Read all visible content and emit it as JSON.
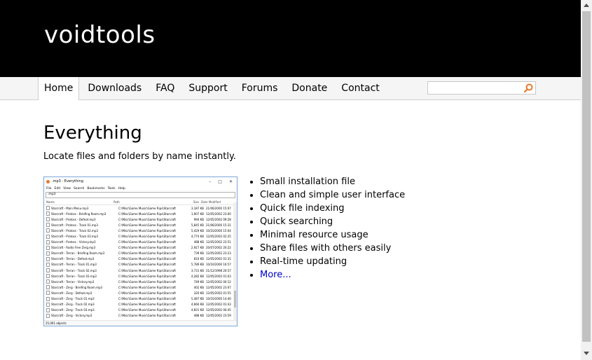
{
  "site": {
    "logo": "voidtools"
  },
  "nav": {
    "items": [
      {
        "label": "Home",
        "active": true
      },
      {
        "label": "Downloads"
      },
      {
        "label": "FAQ"
      },
      {
        "label": "Support"
      },
      {
        "label": "Forums"
      },
      {
        "label": "Donate"
      },
      {
        "label": "Contact"
      }
    ],
    "search_value": ""
  },
  "main": {
    "title": "Everything",
    "subtitle": "Locate files and folders by name instantly.",
    "features": [
      "Small installation file",
      "Clean and simple user interface",
      "Quick file indexing",
      "Quick searching",
      "Minimal resource usage",
      "Share files with others easily",
      "Real-time updating"
    ],
    "more_link": "More..."
  },
  "screenshot": {
    "window_title": ".mp3 - Everything",
    "menu": [
      "File",
      "Edit",
      "View",
      "Search",
      "Bookmarks",
      "Tools",
      "Help"
    ],
    "search_text": ".mp3",
    "columns": [
      "Name",
      "Path",
      "Size",
      "Date Modified"
    ],
    "rows": [
      [
        "Starcraft - Main Menu.mp3",
        "C:\\Misc\\Game Music\\Game Rips\\Starcraft",
        "3,187 KB",
        "21/06/2000 15:07"
      ],
      [
        "Starcraft - Protoss - Briefing Room.mp3",
        "C:\\Misc\\Game Music\\Game Rips\\Starcraft",
        "1,907 KB",
        "12/05/2002 23:00"
      ],
      [
        "Starcraft - Protoss - Defeat.mp3",
        "C:\\Misc\\Game Music\\Game Rips\\Starcraft",
        "994 KB",
        "12/05/2002 09:28"
      ],
      [
        "Starcraft - Protoss - Track 01.mp3",
        "C:\\Misc\\Game Music\\Game Rips\\Starcraft",
        "5,845 KB",
        "21/06/2000 15:31"
      ],
      [
        "Starcraft - Protoss - Track 02.mp3",
        "C:\\Misc\\Game Music\\Game Rips\\Starcraft",
        "5,429 KB",
        "10/10/2000 15:04"
      ],
      [
        "Starcraft - Protoss - Track 03.mp3",
        "C:\\Misc\\Game Music\\Game Rips\\Starcraft",
        "4,774 KB",
        "12/05/2002 02:25"
      ],
      [
        "Starcraft - Protoss - Victory.mp3",
        "C:\\Misc\\Game Music\\Game Rips\\Starcraft",
        "488 KB",
        "12/05/2002 23:51"
      ],
      [
        "Starcraft - Radio Free Zerg.mp3",
        "C:\\Misc\\Game Music\\Game Rips\\Starcraft",
        "2,927 KB",
        "20/07/2002 20:22"
      ],
      [
        "Starcraft - Terran - Briefing Room.mp3",
        "C:\\Misc\\Game Music\\Game Rips\\Starcraft",
        "739 KB",
        "12/05/2002 23:23"
      ],
      [
        "Starcraft - Terran - Defeat.mp3",
        "C:\\Misc\\Game Music\\Game Rips\\Starcraft",
        "810 KB",
        "12/05/2002 01:31"
      ],
      [
        "Starcraft - Terran - Track 01.mp3",
        "C:\\Misc\\Game Music\\Game Rips\\Starcraft",
        "5,789 KB",
        "10/10/2000 16:57"
      ],
      [
        "Starcraft - Terran - Track 02.mp3",
        "C:\\Misc\\Game Music\\Game Rips\\Starcraft",
        "3,731 KB",
        "21/12/1998 20:57"
      ],
      [
        "Starcraft - Terran - Track 03.mp3",
        "C:\\Misc\\Game Music\\Game Rips\\Starcraft",
        "4,282 KB",
        "12/05/2002 01:03"
      ],
      [
        "Starcraft - Terran - Victory.mp3",
        "C:\\Misc\\Game Music\\Game Rips\\Starcraft",
        "749 KB",
        "12/05/2002 00:12"
      ],
      [
        "Starcraft - Zerg - Briefing Room.mp3",
        "C:\\Misc\\Game Music\\Game Rips\\Starcraft",
        "402 KB",
        "12/05/2002 23:07"
      ],
      [
        "Starcraft - Zerg - Defeat.mp3",
        "C:\\Misc\\Game Music\\Game Rips\\Starcraft",
        "320 KB",
        "12/05/2002 01:55"
      ],
      [
        "Starcraft - Zerg - Track 01.mp3",
        "C:\\Misc\\Game Music\\Game Rips\\Starcraft",
        "5,487 KB",
        "10/10/2000 14:40"
      ],
      [
        "Starcraft - Zerg - Track 02.mp3",
        "C:\\Misc\\Game Music\\Game Rips\\Starcraft",
        "4,666 KB",
        "12/05/2002 01:43"
      ],
      [
        "Starcraft - Zerg - Track 03.mp3",
        "C:\\Misc\\Game Music\\Game Rips\\Starcraft",
        "4,601 KB",
        "12/05/2002 00:45"
      ],
      [
        "Starcraft - Zerg - Victory.mp3",
        "C:\\Misc\\Game Music\\Game Rips\\Starcraft",
        "488 KB",
        "12/05/2002 23:59"
      ]
    ],
    "status": "25,061 objects"
  },
  "colors": {
    "header_bg": "#000000",
    "link": "#0000cc",
    "search_icon": "#e8792b"
  }
}
